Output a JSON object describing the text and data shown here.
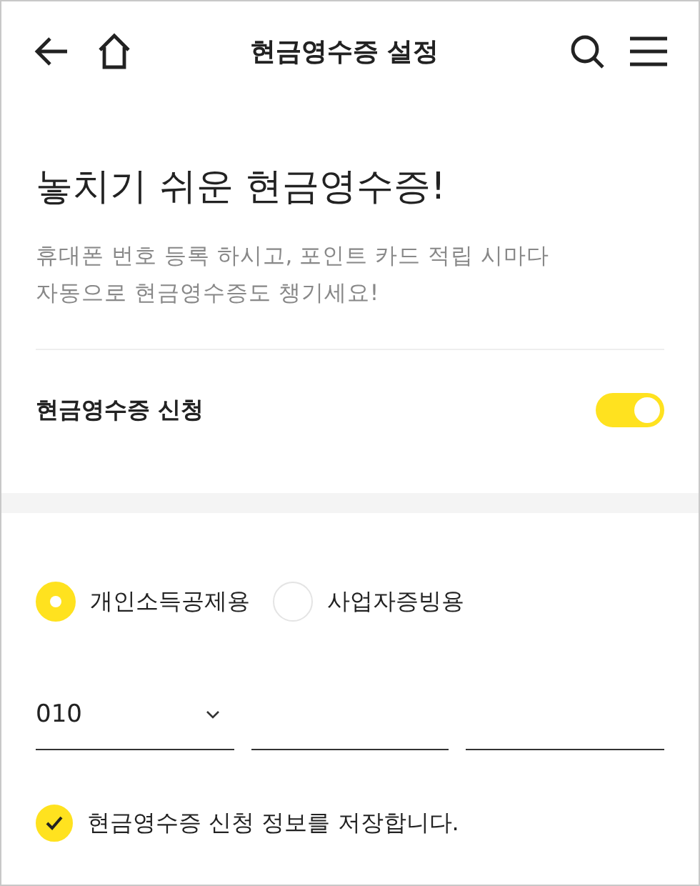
{
  "header": {
    "title": "현금영수증 설정"
  },
  "intro": {
    "heading": "놓치기 쉬운 현금영수증!",
    "lines": [
      "휴대폰 번호 등록 하시고, 포인트 카드 적립 시마다",
      "자동으로 현금영수증도 챙기세요!"
    ]
  },
  "toggle": {
    "label": "현금영수증 신청",
    "on": true
  },
  "purpose_options": [
    {
      "label": "개인소득공제용",
      "selected": true
    },
    {
      "label": "사업자증빙용",
      "selected": false
    }
  ],
  "phone": {
    "prefix": "010"
  },
  "save_info": {
    "label": "현금영수증 신청 정보를 저장합니다.",
    "checked": true
  }
}
